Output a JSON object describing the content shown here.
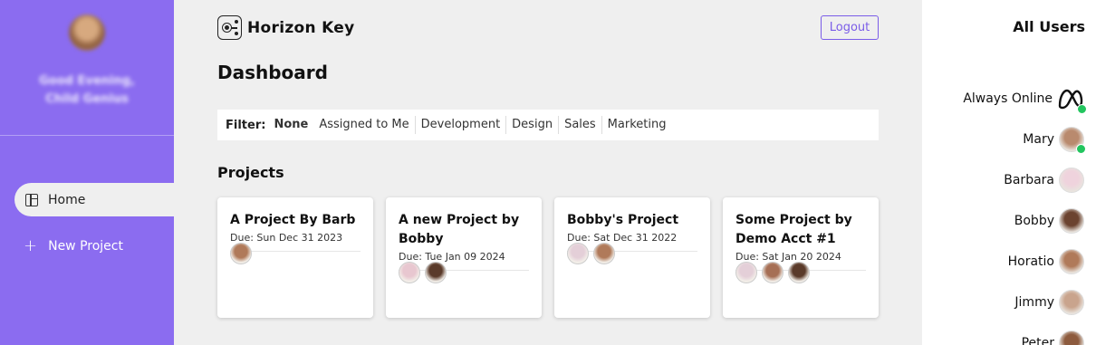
{
  "sidebar": {
    "greeting_line1": "Good Evening,",
    "greeting_line2": "Child Genius",
    "nav": {
      "home": "Home",
      "new_project": "New Project"
    }
  },
  "header": {
    "brand": "Horizon Key",
    "logout": "Logout"
  },
  "main": {
    "title": "Dashboard",
    "filter": {
      "label": "Filter:",
      "options": [
        "None",
        "Assigned to Me",
        "Development",
        "Design",
        "Sales",
        "Marketing"
      ],
      "selected": "None"
    },
    "projects_title": "Projects",
    "projects": [
      {
        "title": "A Project By Barb",
        "due": "Due: Sun Dec 31 2023",
        "members": [
          "#b07a5a"
        ]
      },
      {
        "title": "A new Project by Bobby",
        "due": "Due: Tue Jan 09 2024",
        "members": [
          "#e8c7d0",
          "#5a3a2a"
        ]
      },
      {
        "title": "Bobby's Project",
        "due": "Due: Sat Dec 31 2022",
        "members": [
          "#e4cfd8",
          "#b07a5a"
        ]
      },
      {
        "title": "Some Project by Demo Acct #1",
        "due": "Due: Sat Jan 20 2024",
        "members": [
          "#e4cfd8",
          "#a66f55",
          "#5a3a2a"
        ]
      }
    ]
  },
  "users_panel": {
    "title": "All Users",
    "users": [
      {
        "name": "Always Online",
        "online": true,
        "icon": "meta-logo-icon"
      },
      {
        "name": "Mary",
        "online": true,
        "color": "#b98a6e"
      },
      {
        "name": "Barbara",
        "online": false,
        "color": "#efd3dd"
      },
      {
        "name": "Bobby",
        "online": false,
        "color": "#6b4330"
      },
      {
        "name": "Horatio",
        "online": false,
        "color": "#b07a5a"
      },
      {
        "name": "Jimmy",
        "online": false,
        "color": "#c9a48d"
      },
      {
        "name": "Peter",
        "online": false,
        "color": "#8d5b3e"
      }
    ]
  },
  "colors": {
    "sidebar": "#8b6cf0",
    "accent": "#7a5ce8",
    "online": "#22c55e"
  }
}
